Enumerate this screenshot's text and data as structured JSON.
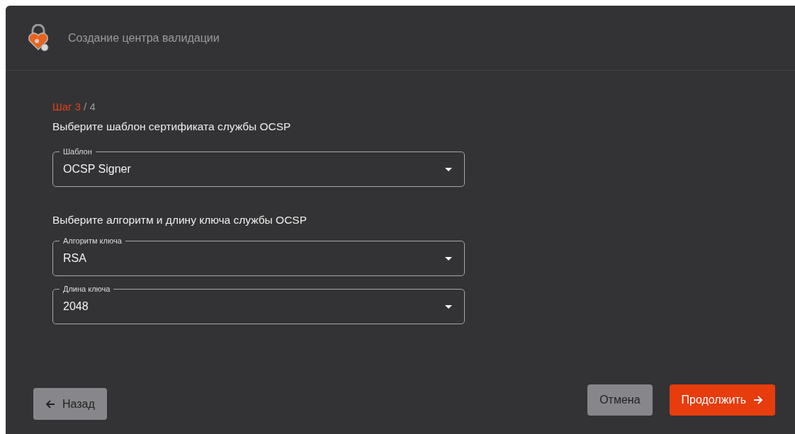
{
  "dialog": {
    "title": "Создание центра валидации"
  },
  "step": {
    "current": "Шаг 3",
    "total": "/ 4"
  },
  "sections": [
    {
      "heading": "Выберите шаблон сертификата службы OCSP",
      "fields": [
        {
          "label": "Шаблон",
          "value": "OCSP Signer"
        }
      ]
    },
    {
      "heading": "Выберите алгоритм и длину ключа службы OCSP",
      "fields": [
        {
          "label": "Алгоритм ключа",
          "value": "RSA"
        },
        {
          "label": "Длина ключа",
          "value": "2048"
        }
      ]
    }
  ],
  "buttons": [
    {
      "kind": "back",
      "label": "Назад"
    },
    {
      "kind": "cancel",
      "label": "Отмена"
    },
    {
      "kind": "next",
      "label": "Продолжить"
    }
  ]
}
